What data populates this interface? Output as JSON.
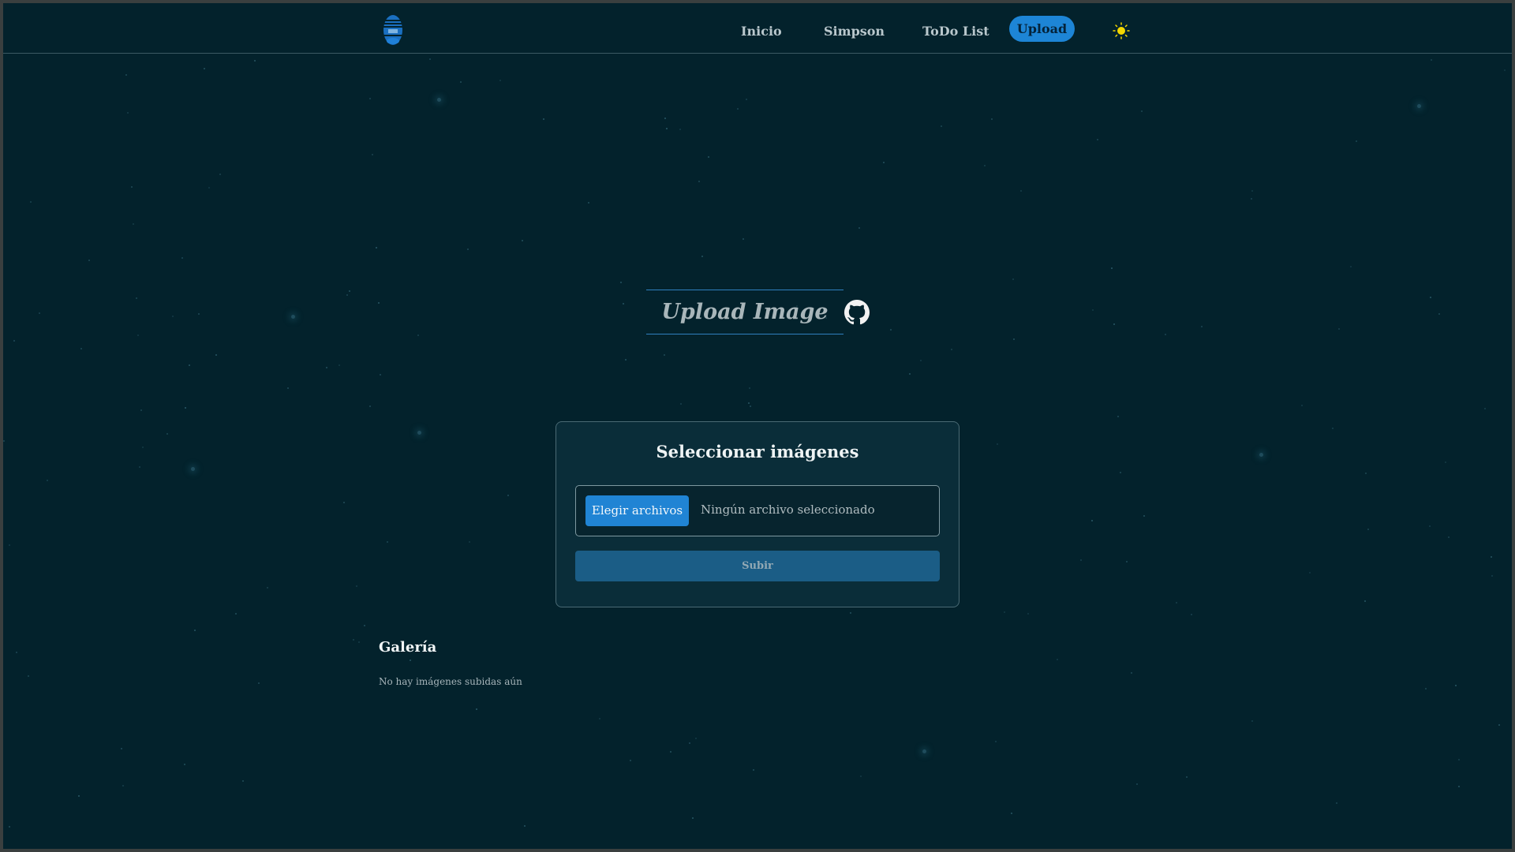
{
  "nav": {
    "items": [
      {
        "label": "Inicio"
      },
      {
        "label": "Simpson"
      },
      {
        "label": "ToDo List"
      }
    ],
    "active_label": "Upload",
    "theme_toggle_icon": "sun-icon",
    "logo_icon": "lantern-logo-icon"
  },
  "hero": {
    "title": "Upload Image",
    "link_icon": "github-icon"
  },
  "upload_card": {
    "title": "Seleccionar imágenes",
    "choose_label": "Elegir archivos",
    "file_status": "Ningún archivo seleccionado",
    "submit_label": "Subir"
  },
  "gallery": {
    "title": "Galería",
    "empty_message": "No hay imágenes subidas aún"
  },
  "colors": {
    "background": "#03222c",
    "accent": "#1d85d6",
    "card": "#0a2d39",
    "submit": "#1b5d86",
    "sun": "#f5d800"
  }
}
